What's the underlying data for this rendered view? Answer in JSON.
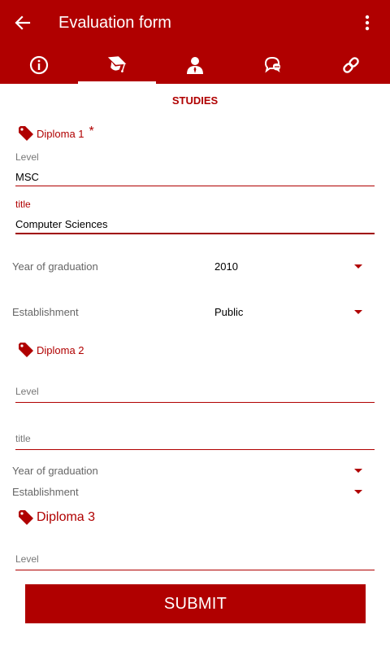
{
  "appbar": {
    "title": "Evaluation form"
  },
  "tabs": [
    {
      "icon": "info-icon"
    },
    {
      "icon": "graduation-cap-icon",
      "active": true
    },
    {
      "icon": "person-icon"
    },
    {
      "icon": "chat-icon"
    },
    {
      "icon": "link-icon"
    }
  ],
  "section_title": "STUDIES",
  "diploma1": {
    "label": "Diploma 1",
    "required_mark": "*",
    "level_label": "Level",
    "level_value": "MSC",
    "title_label": "title",
    "title_value": "Computer Sciences",
    "year_label": "Year of graduation",
    "year_value": "2010",
    "establishment_label": "Establishment",
    "establishment_value": "Public"
  },
  "diploma2": {
    "label": "Diploma 2",
    "level_placeholder": "Level",
    "title_placeholder": "title",
    "year_label": "Year of graduation",
    "establishment_label": "Establishment"
  },
  "diploma3": {
    "label": "Diploma 3",
    "level_placeholder": "Level"
  },
  "submit_label": "SUBMIT",
  "colors": {
    "primary": "#b00000",
    "background": "#ffffff"
  }
}
